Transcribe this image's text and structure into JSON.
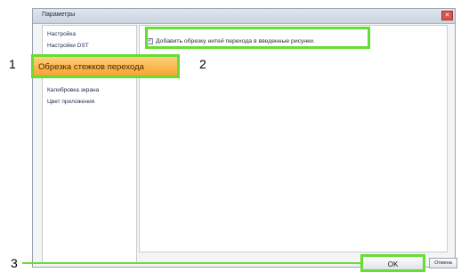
{
  "window": {
    "title": "Параметры",
    "close_symbol": "✕"
  },
  "sidebar": {
    "items": [
      {
        "label": "Настройка"
      },
      {
        "label": "Настройки DST"
      },
      {
        "label": "Обрезка стежков перехода"
      },
      {
        "label": "Калибровка экрана"
      },
      {
        "label": "Цвет приложения"
      }
    ]
  },
  "content": {
    "checkbox_label": "Добавить обрезку нитей перехода в введенные рисунки.",
    "checkbox_checked": true
  },
  "buttons": {
    "ok_label": "OK",
    "cancel_label": "Отмена"
  },
  "callouts": {
    "one": "1",
    "two": "2",
    "three": "3"
  },
  "colors": {
    "highlight": "#66dd33",
    "selected_item": "#f7a531"
  },
  "icons": {
    "close": "close-icon",
    "check": "checkmark-icon"
  }
}
